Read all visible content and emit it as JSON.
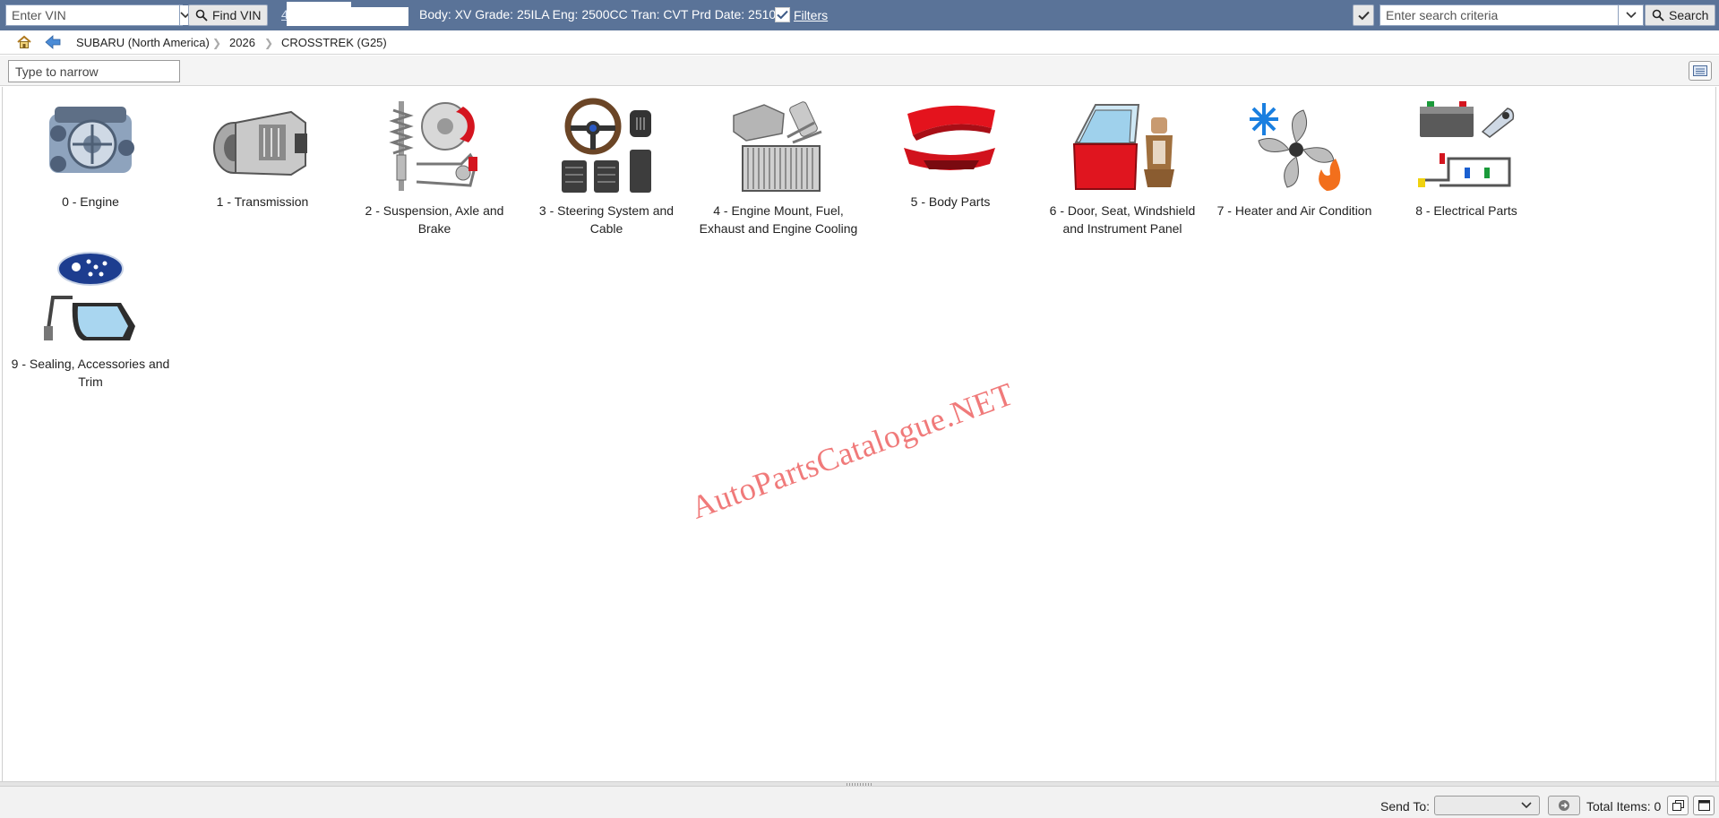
{
  "toolbar": {
    "vin_placeholder": "Enter VIN",
    "find_vin_label": "Find VIN",
    "vin_link": "4",
    "vin_info": "Body: XV Grade: 25ILA Eng: 2500CC Tran: CVT Prd Date: 2510",
    "filters_label": "Filters",
    "filters_checked": true,
    "search_placeholder": "Enter search criteria",
    "search_label": "Search"
  },
  "breadcrumb": {
    "items": [
      "SUBARU (North America)",
      "2026",
      "CROSSTREK (G25)"
    ]
  },
  "filter": {
    "narrow_placeholder": "Type to narrow"
  },
  "categories": [
    {
      "label": "0 - Engine",
      "icon": "engine-icon"
    },
    {
      "label": "1 - Transmission",
      "icon": "transmission-icon"
    },
    {
      "label": "2 - Suspension, Axle and Brake",
      "icon": "suspension-brake-icon"
    },
    {
      "label": "3 - Steering System and Cable",
      "icon": "steering-wheel-icon"
    },
    {
      "label": "4 - Engine Mount, Fuel, Exhaust and Engine Cooling",
      "icon": "radiator-exhaust-icon"
    },
    {
      "label": "5 - Body Parts",
      "icon": "body-panels-icon"
    },
    {
      "label": "6 - Door, Seat, Windshield and Instrument Panel",
      "icon": "door-seat-icon"
    },
    {
      "label": "7 - Heater and Air Condition",
      "icon": "fan-snowflake-flame-icon"
    },
    {
      "label": "8 - Electrical Parts",
      "icon": "battery-wiring-icon"
    },
    {
      "label": "9 - Sealing, Accessories and Trim",
      "icon": "subaru-logo-mirror-icon"
    }
  ],
  "watermark": "AutoPartsCatalogue.NET",
  "bottom": {
    "send_to_label": "Send To:",
    "send_to_value": "",
    "total_items": "Total Items: 0"
  }
}
